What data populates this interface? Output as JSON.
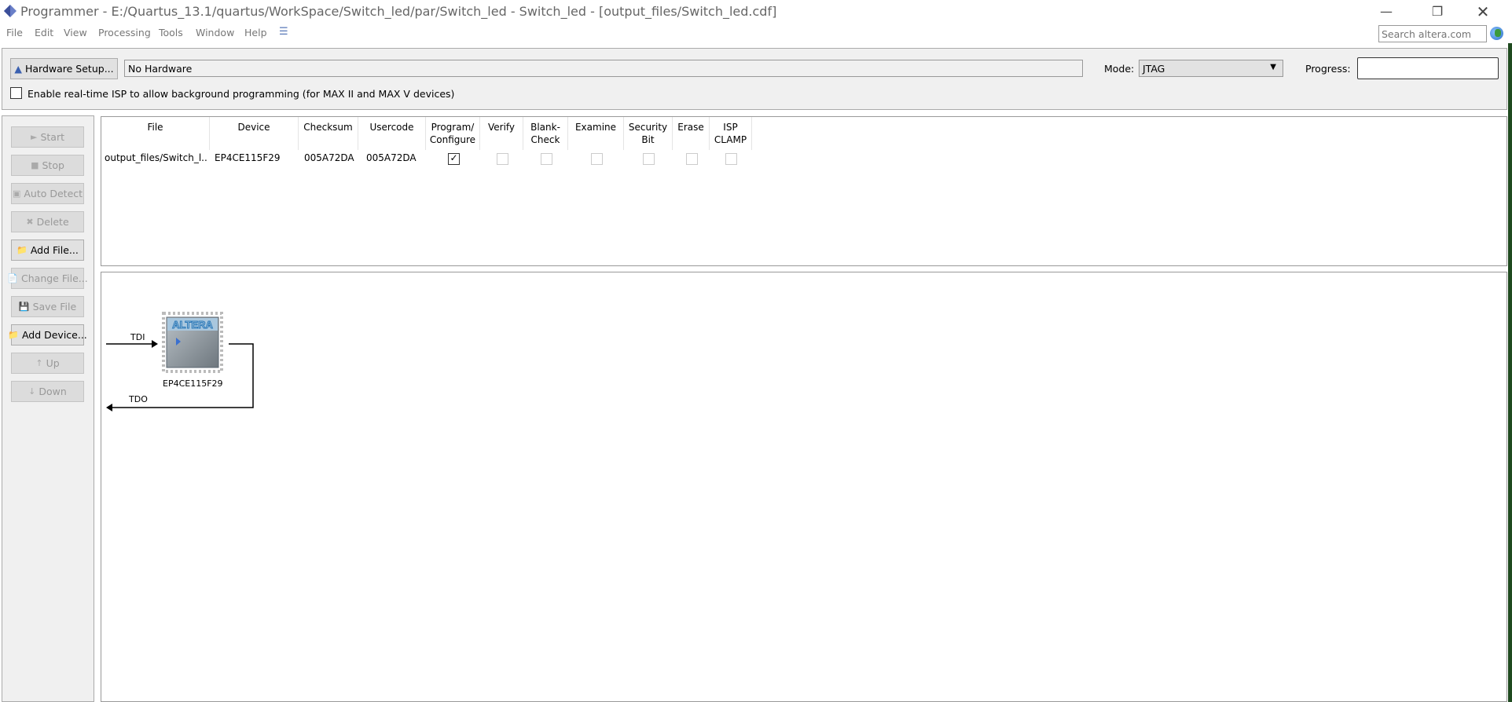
{
  "window": {
    "title": "Programmer - E:/Quartus_13.1/quartus/WorkSpace/Switch_led/par/Switch_led - Switch_led - [output_files/Switch_led.cdf]",
    "controls": [
      "minimize",
      "restore",
      "close"
    ]
  },
  "menu": {
    "items": [
      "File",
      "Edit",
      "View",
      "Processing",
      "Tools",
      "Window",
      "Help"
    ],
    "search_placeholder": "Search altera.com"
  },
  "hardware": {
    "setup_label": "Hardware Setup...",
    "current": "No Hardware",
    "mode_label": "Mode:",
    "mode_value": "JTAG",
    "progress_label": "Progress:",
    "progress_value": "",
    "isp_label": "Enable real-time ISP to allow background programming (for MAX II and MAX V devices)",
    "isp_checked": false
  },
  "sidebar": {
    "buttons": [
      {
        "label": "Start",
        "enabled": false
      },
      {
        "label": "Stop",
        "enabled": false
      },
      {
        "label": "Auto Detect",
        "enabled": false
      },
      {
        "label": "Delete",
        "enabled": false
      },
      {
        "label": "Add File...",
        "enabled": true
      },
      {
        "label": "Change File...",
        "enabled": false
      },
      {
        "label": "Save File",
        "enabled": false
      },
      {
        "label": "Add Device...",
        "enabled": true
      },
      {
        "label": "Up",
        "enabled": false
      },
      {
        "label": "Down",
        "enabled": false
      }
    ]
  },
  "table": {
    "headers": [
      "File",
      "Device",
      "Checksum",
      "Usercode",
      "Program/\nConfigure",
      "Verify",
      "Blank-\nCheck",
      "Examine",
      "Security\nBit",
      "Erase",
      "ISP\nCLAMP"
    ],
    "rows": [
      {
        "file": "output_files/Switch_l...",
        "device": "EP4CE115F29",
        "checksum": "005A72DA",
        "usercode": "005A72DA",
        "program": true,
        "verify": false,
        "blank_check": false,
        "examine": false,
        "security_bit": false,
        "erase": false,
        "isp_clamp": false
      }
    ]
  },
  "chain": {
    "tdi": "TDI",
    "tdo": "TDO",
    "device": "EP4CE115F29",
    "logo": "ALTERA"
  },
  "colors": {
    "panel": "#f0f0f0",
    "chip": "#8a9399",
    "logo": "#2a78b8"
  }
}
